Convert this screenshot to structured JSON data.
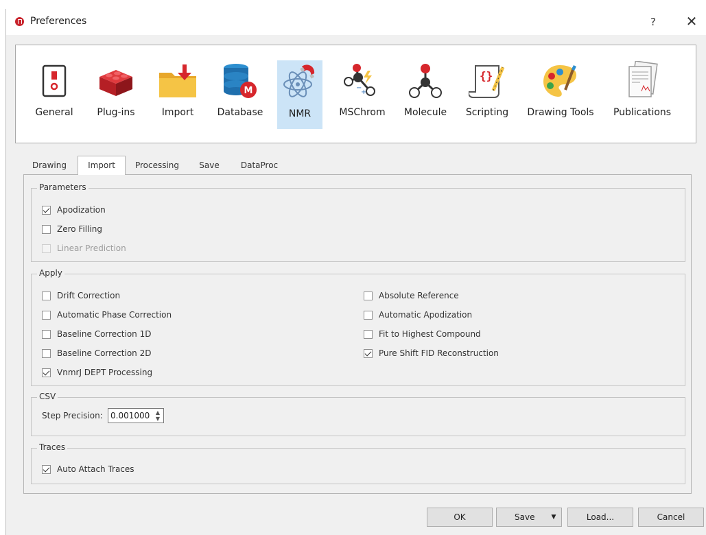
{
  "window": {
    "title": "Preferences",
    "help": "?",
    "close": "✕"
  },
  "toolbar": {
    "items": [
      {
        "id": "general",
        "label": "General",
        "icon": "switch-icon"
      },
      {
        "id": "plugins",
        "label": "Plug-ins",
        "icon": "lego-bricks-icon"
      },
      {
        "id": "import",
        "label": "Import",
        "icon": "folder-import-icon"
      },
      {
        "id": "database",
        "label": "Database",
        "icon": "database-icon"
      },
      {
        "id": "nmr",
        "label": "NMR",
        "icon": "atom-magnet-icon",
        "selected": true
      },
      {
        "id": "mschrom",
        "label": "MSChrom",
        "icon": "ion-molecule-icon"
      },
      {
        "id": "molecule",
        "label": "Molecule",
        "icon": "molecule-icon"
      },
      {
        "id": "scripting",
        "label": "Scripting",
        "icon": "script-scroll-icon"
      },
      {
        "id": "drawing_tools",
        "label": "Drawing Tools",
        "icon": "palette-icon"
      },
      {
        "id": "publications",
        "label": "Publications",
        "icon": "documents-icon"
      }
    ]
  },
  "tabs": [
    {
      "label": "Drawing"
    },
    {
      "label": "Import",
      "active": true
    },
    {
      "label": "Processing"
    },
    {
      "label": "Save"
    },
    {
      "label": "DataProc"
    }
  ],
  "parameters": {
    "title": "Parameters",
    "items": [
      {
        "label": "Apodization",
        "checked": true
      },
      {
        "label": "Zero Filling",
        "checked": false
      },
      {
        "label": "Linear Prediction",
        "checked": false,
        "disabled": true
      }
    ]
  },
  "apply": {
    "title": "Apply",
    "left": [
      {
        "label": "Drift Correction",
        "checked": false
      },
      {
        "label": "Automatic Phase Correction",
        "checked": false
      },
      {
        "label": "Baseline Correction 1D",
        "checked": false
      },
      {
        "label": "Baseline Correction 2D",
        "checked": false
      },
      {
        "label": "VnmrJ DEPT Processing",
        "checked": true
      }
    ],
    "right": [
      {
        "label": "Absolute Reference",
        "checked": false
      },
      {
        "label": "Automatic Apodization",
        "checked": false
      },
      {
        "label": "Fit to Highest Compound",
        "checked": false
      },
      {
        "label": "Pure Shift FID Reconstruction",
        "checked": true
      }
    ]
  },
  "csv": {
    "title": "CSV",
    "step_label": "Step Precision:",
    "step_value": "0.001000"
  },
  "traces": {
    "title": "Traces",
    "items": [
      {
        "label": "Auto Attach Traces",
        "checked": true
      }
    ]
  },
  "buttons": {
    "ok": "OK",
    "save": "Save",
    "load": "Load...",
    "cancel": "Cancel"
  },
  "colors": {
    "selected_bg": "#cce4f7",
    "brand_red": "#c8232c"
  }
}
